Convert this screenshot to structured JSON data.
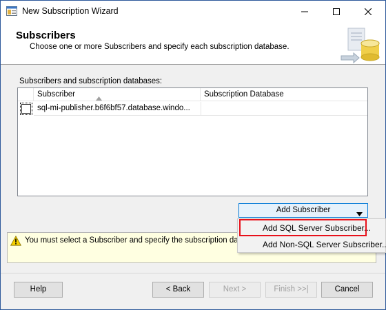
{
  "window": {
    "title": "New Subscription Wizard",
    "icon": "wizard-app-icon"
  },
  "header": {
    "title": "Subscribers",
    "subtitle": "Choose one or more Subscribers and specify each subscription database."
  },
  "grid": {
    "label": "Subscribers and subscription databases:",
    "columns": [
      "Subscriber",
      "Subscription Database"
    ],
    "sort_column": "Subscriber",
    "rows": [
      {
        "checked": false,
        "subscriber": "sql-mi-publisher.b6f6bf57.database.windo...",
        "database": ""
      }
    ]
  },
  "add_subscriber": {
    "label": "Add Subscriber",
    "menu": [
      {
        "label": "Add SQL Server Subscriber...",
        "highlighted": true
      },
      {
        "label": "Add Non-SQL Server Subscriber...",
        "highlighted": false
      }
    ]
  },
  "warning": {
    "icon": "warning-icon",
    "text": "You must select a Subscriber and specify the subscription databas"
  },
  "buttons": {
    "help": "Help",
    "back": "< Back",
    "next": "Next >",
    "finish": "Finish >>|",
    "cancel": "Cancel"
  },
  "colors": {
    "accent": "#0078d7",
    "highlight": "#e8101a",
    "warning_bg": "#ffffe1"
  }
}
